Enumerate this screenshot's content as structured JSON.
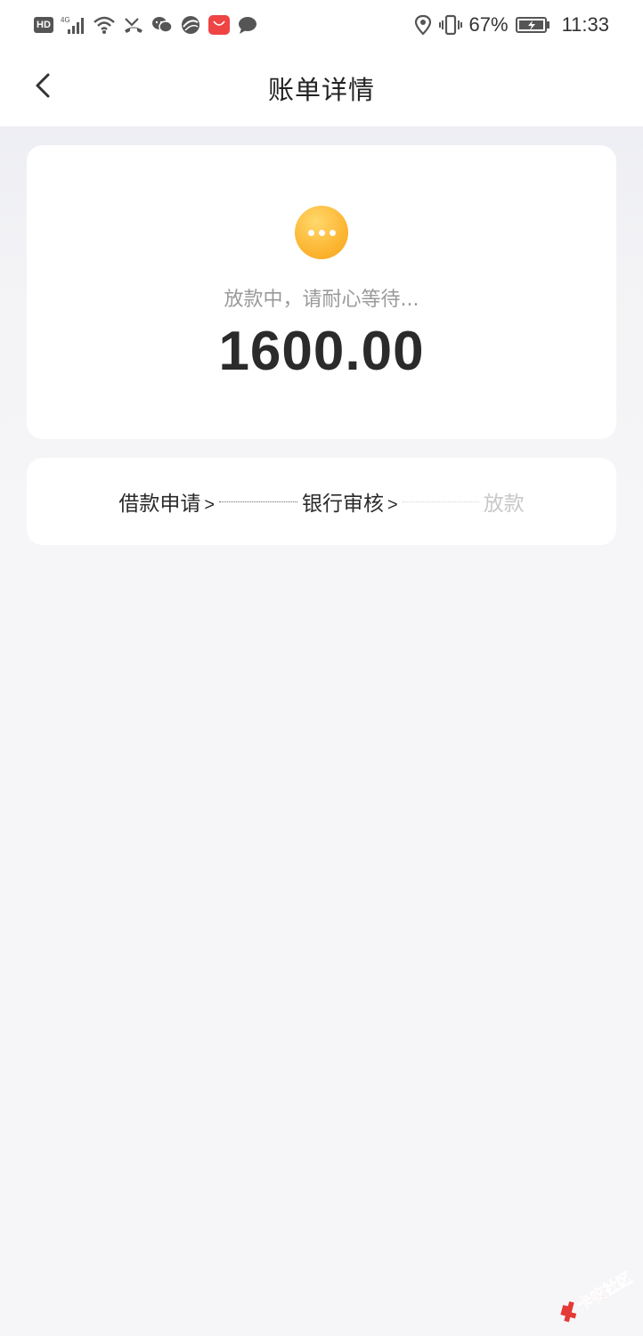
{
  "status_bar": {
    "hd_label": "HD",
    "battery_percent": "67%",
    "time": "11:33"
  },
  "header": {
    "title": "账单详情"
  },
  "status_card": {
    "icon": "more-dots-icon",
    "status_text": "放款中，请耐心等待...",
    "amount": "1600.00"
  },
  "progress": {
    "steps": [
      {
        "label": "借款申请",
        "arrow": ">",
        "state": "done"
      },
      {
        "label": "银行审核",
        "arrow": ">",
        "state": "done"
      },
      {
        "label": "放款",
        "arrow": "",
        "state": "pending"
      }
    ]
  },
  "watermark": {
    "text": "卡农社区"
  },
  "colors": {
    "accent_orange": "#fcb633",
    "text_primary": "#2b2b2b",
    "text_muted": "#9a9a9a",
    "step_pending": "#c8c8c8"
  }
}
